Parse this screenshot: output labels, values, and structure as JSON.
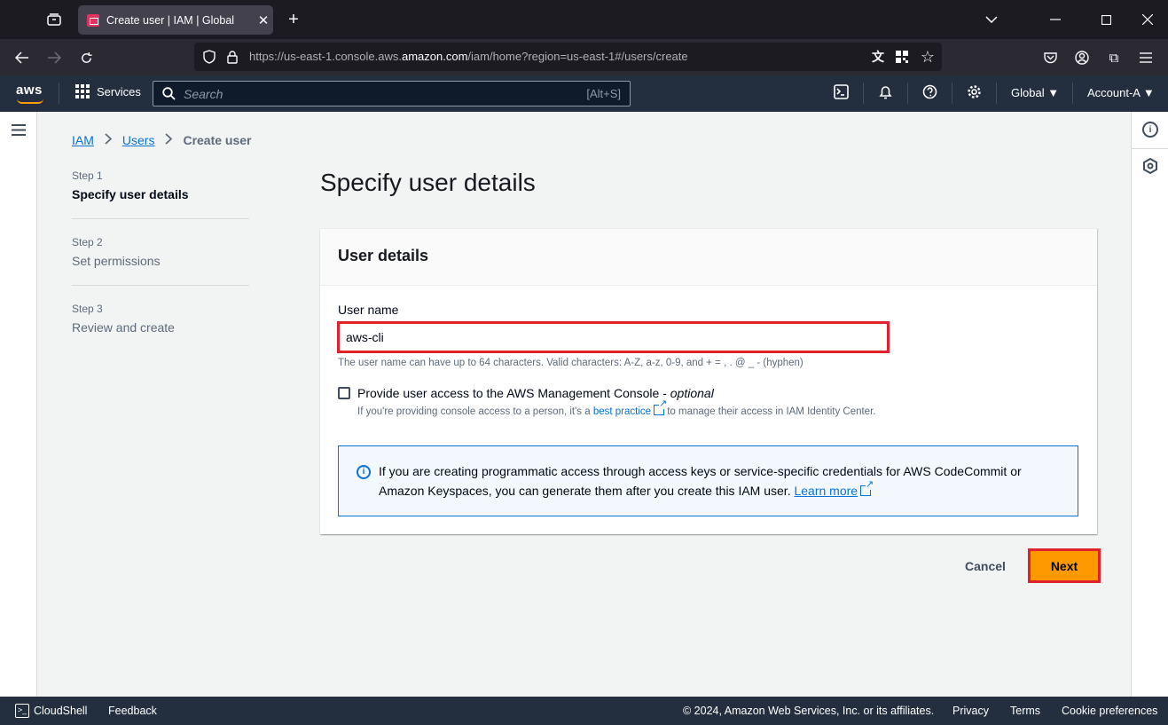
{
  "browser": {
    "tab_title": "Create user | IAM | Global",
    "url_prefix": "https://us-east-1.console.aws.",
    "url_domain": "amazon.com",
    "url_suffix": "/iam/home?region=us-east-1#/users/create"
  },
  "aws_header": {
    "logo": "aws",
    "services_label": "Services",
    "search_placeholder": "Search",
    "search_shortcut": "[Alt+S]",
    "region": "Global",
    "account": "Account-A"
  },
  "breadcrumb": {
    "items": [
      "IAM",
      "Users"
    ],
    "current": "Create user"
  },
  "steps": [
    {
      "number": "Step 1",
      "title": "Specify user details"
    },
    {
      "number": "Step 2",
      "title": "Set permissions"
    },
    {
      "number": "Step 3",
      "title": "Review and create"
    }
  ],
  "main": {
    "heading": "Specify user details",
    "card_title": "User details",
    "username_label": "User name",
    "username_value": "aws-cli",
    "username_hint": "The user name can have up to 64 characters. Valid characters: A-Z, a-z, 0-9, and + = , . @ _ - (hyphen)",
    "console_access_label": "Provide user access to the AWS Management Console - ",
    "console_access_optional": "optional",
    "console_access_desc_1": "If you're providing console access to a person, it's a ",
    "console_access_link": "best practice",
    "console_access_desc_2": " to manage their access in IAM Identity Center.",
    "info_text": "If you are creating programmatic access through access keys or service-specific credentials for AWS CodeCommit or Amazon Keyspaces, you can generate them after you create this IAM user. ",
    "info_link": "Learn more"
  },
  "actions": {
    "cancel": "Cancel",
    "next": "Next"
  },
  "footer": {
    "cloudshell": "CloudShell",
    "feedback": "Feedback",
    "copyright": "© 2024, Amazon Web Services, Inc. or its affiliates.",
    "privacy": "Privacy",
    "terms": "Terms",
    "cookies": "Cookie preferences"
  },
  "colors": {
    "aws_header": "#232f3e",
    "primary_button": "#ff9900",
    "link": "#0972d3",
    "highlight": "#e0212d"
  }
}
